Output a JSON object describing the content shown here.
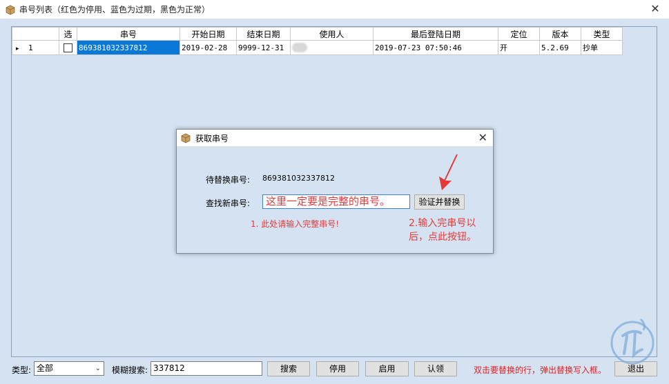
{
  "window": {
    "title": "串号列表（红色为停用、蓝色为过期，黑色为正常）"
  },
  "grid": {
    "headers": [
      "",
      "选",
      "串号",
      "开始日期",
      "结束日期",
      "使用人",
      "最后登陆日期",
      "定位",
      "版本",
      "类型"
    ],
    "rows": [
      {
        "indicator": "▸",
        "index": "1",
        "serial": "869381032337812",
        "start_date": "2019-02-28",
        "end_date": "9999-12-31",
        "user": "",
        "last_login": "2019-07-23 07:50:46",
        "locate": "开",
        "version": "5.2.69",
        "type": "抄单"
      }
    ]
  },
  "dialog": {
    "title": "获取串号",
    "replace_label": "待替换串号:",
    "replace_value": "869381032337812",
    "new_label": "查找新串号:",
    "new_value": "这里一定要是完整的串号。",
    "verify_button": "验证并替换",
    "note1": "1. 此处请输入完整串号!",
    "note2": "2.输入完串号以后，点此按钮。"
  },
  "bottom": {
    "type_label": "类型:",
    "type_value": "全部",
    "search_label": "模糊搜索:",
    "search_value": "337812",
    "search_button": "搜索",
    "disable_button": "停用",
    "enable_button": "启用",
    "approve_button": "认领",
    "hint": "双击要替换的行，弹出替换写入框。",
    "exit_button": "退出"
  },
  "colors": {
    "accent": "#0a78d7",
    "note_red": "#e53a3a",
    "background": "#d4e2f1"
  }
}
